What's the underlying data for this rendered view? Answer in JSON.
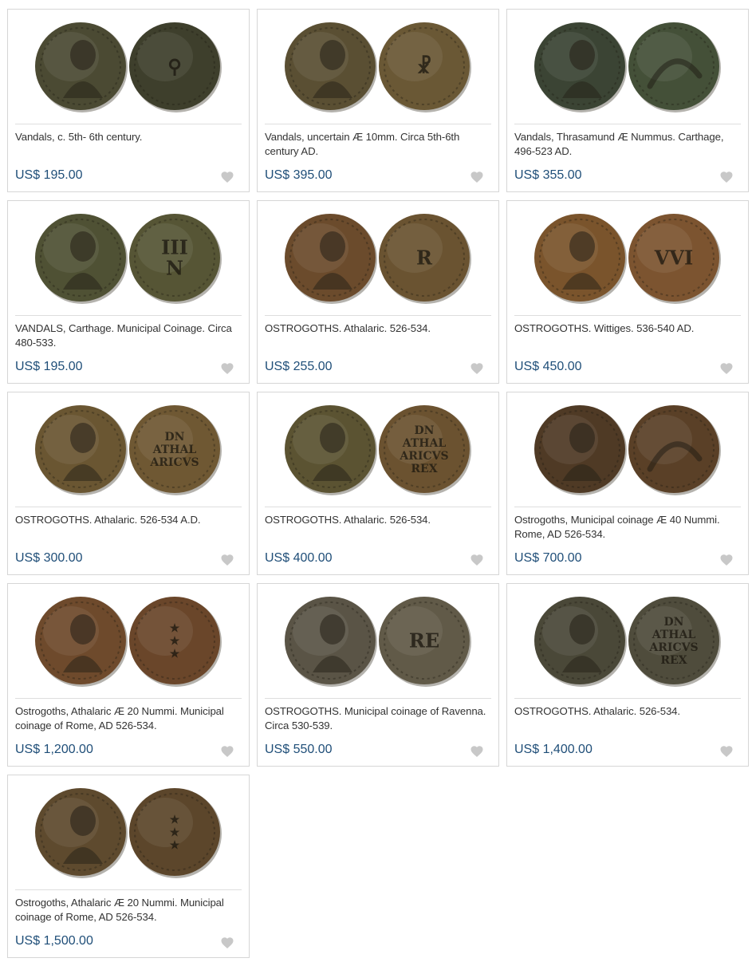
{
  "listings": [
    {
      "title": "Vandals, c. 5th- 6th century.",
      "price": "US$ 195.00",
      "coins": [
        {
          "fill": "#4b4a33",
          "glyph": ""
        },
        {
          "fill": "#3e3f2c",
          "glyph": "⚲"
        }
      ]
    },
    {
      "title": "Vandals, uncertain Æ 10mm. Circa 5th-6th century AD.",
      "price": "US$ 395.00",
      "coins": [
        {
          "fill": "#5a4f33",
          "glyph": ""
        },
        {
          "fill": "#6a5835",
          "glyph": "☧"
        }
      ]
    },
    {
      "title": "Vandals, Thrasamund Æ Nummus. Carthage, 496-523 AD.",
      "price": "US$ 355.00",
      "coins": [
        {
          "fill": "#3b4434",
          "glyph": ""
        },
        {
          "fill": "#445038",
          "glyph": ""
        }
      ]
    },
    {
      "title": "VANDALS, Carthage. Municipal Coinage. Circa 480-533.",
      "price": "US$ 195.00",
      "coins": [
        {
          "fill": "#4f5134",
          "glyph": ""
        },
        {
          "fill": "#565535",
          "glyph": "III N"
        }
      ]
    },
    {
      "title": "OSTROGOTHS. Athalaric. 526-534.",
      "price": "US$ 255.00",
      "coins": [
        {
          "fill": "#6b4b2c",
          "glyph": ""
        },
        {
          "fill": "#6a5331",
          "glyph": "R"
        }
      ]
    },
    {
      "title": "OSTROGOTHS. Wittiges. 536-540 AD.",
      "price": "US$ 450.00",
      "coins": [
        {
          "fill": "#7a542c",
          "glyph": ""
        },
        {
          "fill": "#7c5430",
          "glyph": "VVI"
        }
      ]
    },
    {
      "title": "OSTROGOTHS. Athalaric. 526-534 A.D.",
      "price": "US$ 300.00",
      "coins": [
        {
          "fill": "#6a5632",
          "glyph": ""
        },
        {
          "fill": "#6f5833",
          "glyph": "DN ATHAL ARICVS"
        }
      ]
    },
    {
      "title": "OSTROGOTHS. Athalaric. 526-534.",
      "price": "US$ 400.00",
      "coins": [
        {
          "fill": "#5b5332",
          "glyph": ""
        },
        {
          "fill": "#6b5230",
          "glyph": "DN ATHAL ARICVS REX"
        }
      ]
    },
    {
      "title": "Ostrogoths, Municipal coinage Æ 40 Nummi. Rome, AD 526-534.",
      "price": "US$ 700.00",
      "coins": [
        {
          "fill": "#4f3a25",
          "glyph": ""
        },
        {
          "fill": "#5a4027",
          "glyph": ""
        }
      ]
    },
    {
      "title": "Ostrogoths, Athalaric Æ 20 Nummi. Municipal coinage of Rome, AD 526-534.",
      "price": "US$ 1,200.00",
      "coins": [
        {
          "fill": "#6e4a2c",
          "glyph": ""
        },
        {
          "fill": "#6a462a",
          "glyph": "★ ★ ★"
        }
      ]
    },
    {
      "title": "OSTROGOTHS. Municipal coinage of Ravenna. Circa 530-539.",
      "price": "US$ 550.00",
      "coins": [
        {
          "fill": "#5a5446",
          "glyph": ""
        },
        {
          "fill": "#615a48",
          "glyph": "RE"
        }
      ]
    },
    {
      "title": "OSTROGOTHS. Athalaric. 526-534.",
      "price": "US$ 1,400.00",
      "coins": [
        {
          "fill": "#4a4838",
          "glyph": ""
        },
        {
          "fill": "#4f4c3c",
          "glyph": "DN ATHAL ARICVS REX"
        }
      ]
    },
    {
      "title": "Ostrogoths, Athalaric Æ 20 Nummi. Municipal coinage of Rome, AD 526-534.",
      "price": "US$ 1,500.00",
      "coins": [
        {
          "fill": "#5e4a2e",
          "glyph": ""
        },
        {
          "fill": "#5c462b",
          "glyph": "★ ★ ★"
        }
      ]
    }
  ],
  "icons": {
    "favorite": "heart-icon",
    "coin_image": "coin-photo"
  },
  "colors": {
    "price": "#1f4e78",
    "heart": "#c8c8c8",
    "border": "#d6d6d6"
  }
}
